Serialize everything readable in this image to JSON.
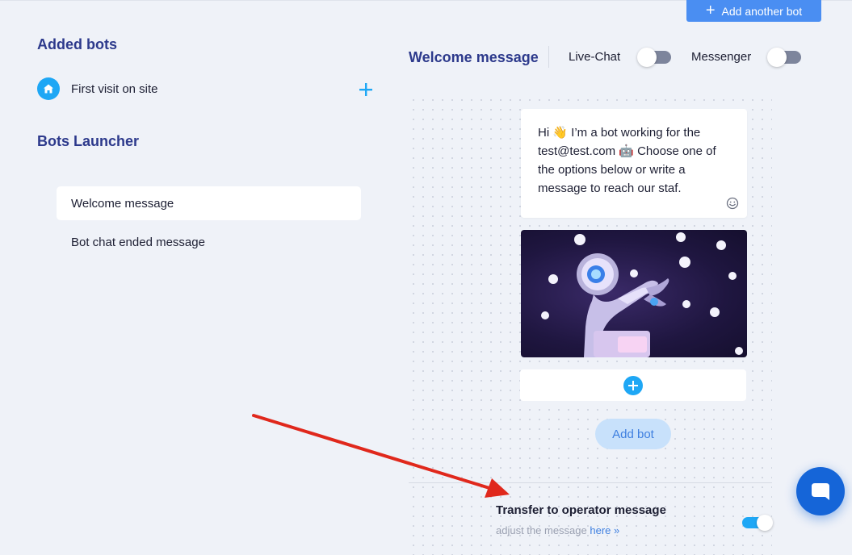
{
  "header": {
    "add_another_bot_label": "Add another bot"
  },
  "sidebar": {
    "added_bots_title": "Added bots",
    "bots": [
      {
        "label": "First visit on site"
      }
    ],
    "bots_launcher_title": "Bots Launcher",
    "launcher_items": [
      {
        "label": "Welcome message",
        "active": true
      },
      {
        "label": "Bot chat ended message",
        "active": false
      }
    ]
  },
  "main": {
    "title": "Welcome message",
    "toggles": {
      "live_chat_label": "Live-Chat",
      "live_chat_on": false,
      "messenger_label": "Messenger",
      "messenger_on": false
    },
    "message_text": "Hi 👋 I’m a bot working for the test@test.com 🤖 Choose one of the options below or write a message to reach our staf.",
    "add_bot_label": "Add bot",
    "transfer": {
      "title": "Transfer to operator message",
      "subtitle": "adjust the message",
      "link": "here »",
      "enabled": true
    }
  },
  "colors": {
    "accent": "#1ea7f5",
    "primary_button": "#4a8ef2",
    "heading": "#2d3a8c",
    "annotation_arrow": "#e0281c"
  },
  "icons": {
    "home": "home-icon",
    "plus": "plus-icon",
    "smiley": "smiley-icon",
    "chat": "chat-icon"
  }
}
